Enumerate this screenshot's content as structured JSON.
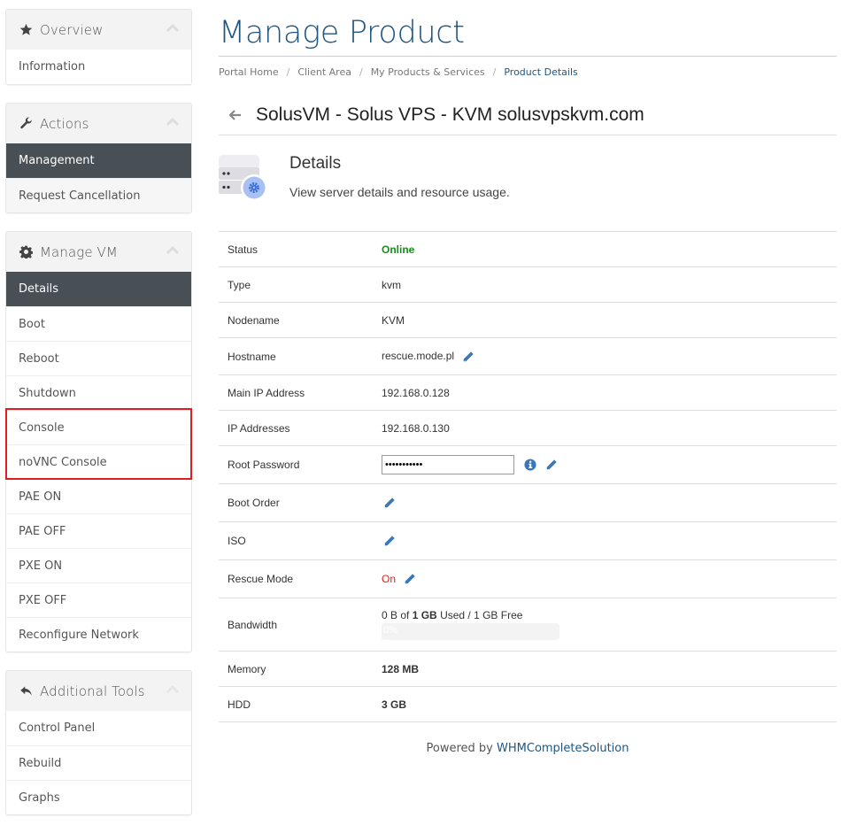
{
  "sidebar": {
    "panels": [
      {
        "title": "Overview",
        "icon": "star-icon",
        "items": [
          {
            "label": "Information",
            "active": false
          }
        ]
      },
      {
        "title": "Actions",
        "icon": "wrench-icon",
        "items": [
          {
            "label": "Management",
            "active": true
          },
          {
            "label": "Request Cancellation",
            "active": false
          }
        ]
      },
      {
        "title": "Manage VM",
        "icon": "gear-icon",
        "items": [
          {
            "label": "Details",
            "active": true
          },
          {
            "label": "Boot",
            "active": false
          },
          {
            "label": "Reboot",
            "active": false
          },
          {
            "label": "Shutdown",
            "active": false
          },
          {
            "label": "Console",
            "active": false
          },
          {
            "label": "noVNC Console",
            "active": false
          },
          {
            "label": "PAE ON",
            "active": false
          },
          {
            "label": "PAE OFF",
            "active": false
          },
          {
            "label": "PXE ON",
            "active": false
          },
          {
            "label": "PXE OFF",
            "active": false
          },
          {
            "label": "Reconfigure Network",
            "active": false
          }
        ]
      },
      {
        "title": "Additional Tools",
        "icon": "reply-icon",
        "items": [
          {
            "label": "Control Panel",
            "active": false
          },
          {
            "label": "Rebuild",
            "active": false
          },
          {
            "label": "Graphs",
            "active": false
          }
        ]
      }
    ],
    "highlight_color": "#e31b23"
  },
  "header": {
    "title": "Manage Product",
    "breadcrumb": [
      "Portal Home",
      "Client Area",
      "My Products & Services",
      "Product Details"
    ],
    "breadcrumb_separator": "/"
  },
  "product": {
    "title": "SolusVM - Solus VPS - KVM solusvpskvm.com",
    "section_title": "Details",
    "section_description": "View server details and resource usage."
  },
  "details": {
    "status": {
      "label": "Status",
      "value": "Online"
    },
    "type": {
      "label": "Type",
      "value": "kvm"
    },
    "nodename": {
      "label": "Nodename",
      "value": "KVM"
    },
    "hostname": {
      "label": "Hostname",
      "value": "rescue.mode.pl"
    },
    "main_ip": {
      "label": "Main IP Address",
      "value": "192.168.0.128"
    },
    "ip_addresses": {
      "label": "IP Addresses",
      "value": "192.168.0.130"
    },
    "root_password": {
      "label": "Root Password",
      "value": "•••••••••••"
    },
    "boot_order": {
      "label": "Boot Order"
    },
    "iso": {
      "label": "ISO"
    },
    "rescue_mode": {
      "label": "Rescue Mode",
      "value": "On"
    },
    "bandwidth": {
      "label": "Bandwidth",
      "used": "0 B",
      "of_text": "of",
      "total": "1 GB",
      "suffix": "Used / 1 GB Free",
      "percent_label": "0%",
      "percent": 0
    },
    "memory": {
      "label": "Memory",
      "value": "128 MB"
    },
    "hdd": {
      "label": "HDD",
      "value": "3 GB"
    }
  },
  "footer": {
    "prefix": "Powered by",
    "link": "WHMCompleteSolution"
  },
  "colors": {
    "brand": "#1f5681",
    "active_item": "#484f55",
    "online": "#1d8c1d",
    "rescue_on": "#e0201b",
    "edit_icon": "#3a78b8"
  }
}
